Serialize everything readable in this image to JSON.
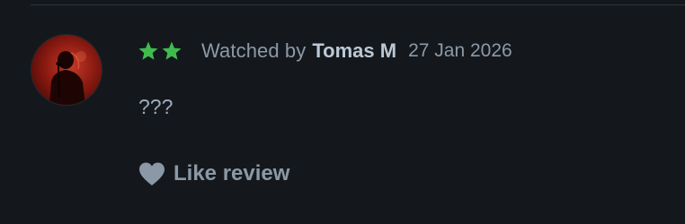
{
  "review": {
    "rating_stars": 2,
    "watched_prefix": "Watched by",
    "author": "Tomas M",
    "date": "27 Jan 2026",
    "body": "???"
  },
  "actions": {
    "like_label": "Like review"
  },
  "icons": {
    "avatar": "avatar",
    "star": "star-icon",
    "like": "heart-icon"
  },
  "colors": {
    "background": "#14181c",
    "star_green": "#40bc4e",
    "muted_text": "#8c99a8",
    "author_text": "#bcc8d6"
  }
}
